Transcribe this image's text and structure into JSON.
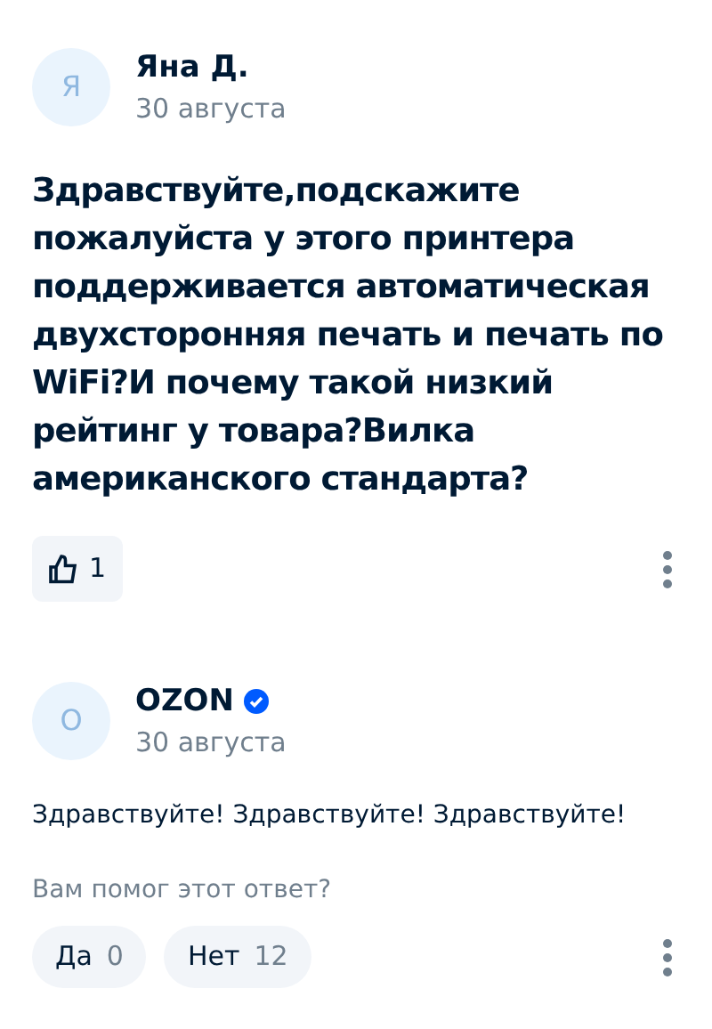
{
  "question": {
    "author": {
      "initial": "Я",
      "name": "Яна Д.",
      "date": "30 августа"
    },
    "text": "Здравствуйте,подскажите пожалуйста у этого принтера поддерживается автоматическая двухсторонняя печать и печать по WiFi?И почему такой низкий рейтинг у товара?Вилка американского стандарта?",
    "likes": "1"
  },
  "answer": {
    "author": {
      "initial": "O",
      "name": "OZON",
      "date": "30 августа",
      "verified": true
    },
    "text": "Здравствуйте! Здравствуйте! Здравствуйте!",
    "helpful_prompt": "Вам помог этот ответ?",
    "votes": [
      {
        "label": "Да",
        "count": "0"
      },
      {
        "label": "Нет",
        "count": "12"
      }
    ]
  }
}
